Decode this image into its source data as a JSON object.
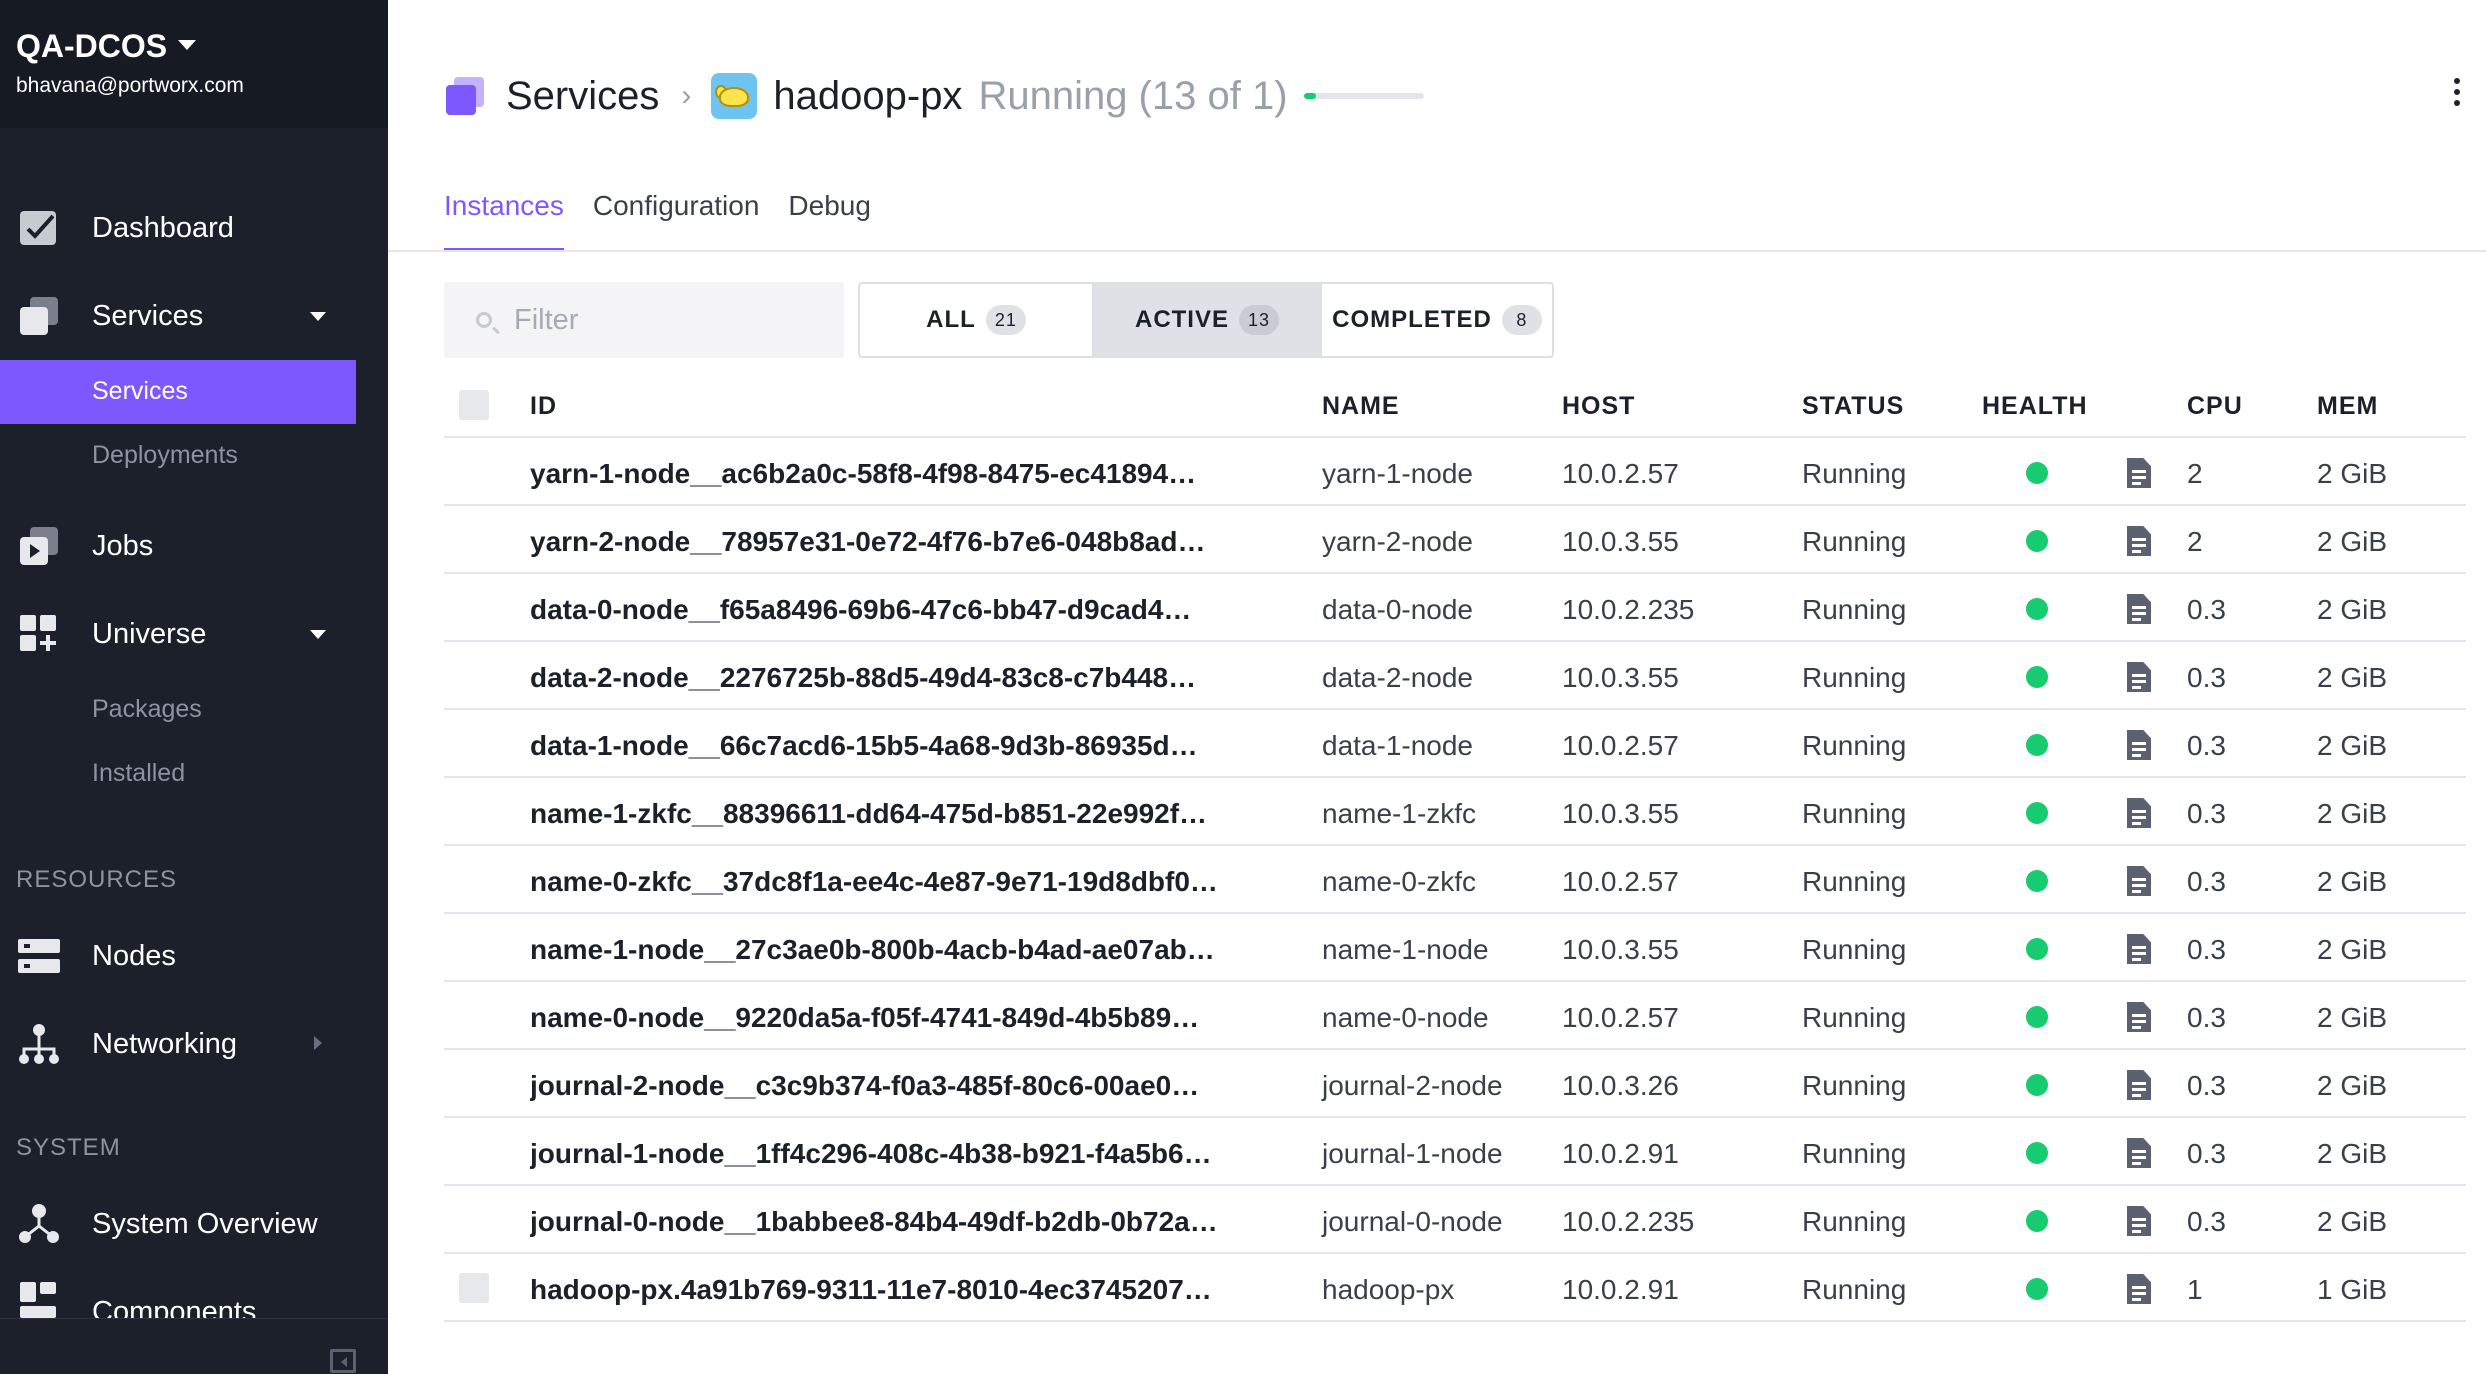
{
  "sidebar": {
    "cluster_name": "QA-DCOS",
    "user_email": "bhavana@portworx.com",
    "items": [
      {
        "label": "Dashboard",
        "icon": "dashboard-icon"
      },
      {
        "label": "Services",
        "icon": "services-icon"
      },
      {
        "label": "Jobs",
        "icon": "jobs-icon"
      },
      {
        "label": "Universe",
        "icon": "universe-icon"
      },
      {
        "label": "Nodes",
        "icon": "nodes-icon"
      },
      {
        "label": "Networking",
        "icon": "networking-icon"
      },
      {
        "label": "System Overview",
        "icon": "system-overview-icon"
      },
      {
        "label": "Components",
        "icon": "components-icon"
      }
    ],
    "services_sub": [
      "Services",
      "Deployments"
    ],
    "universe_sub": [
      "Packages",
      "Installed"
    ],
    "sections": [
      "RESOURCES",
      "SYSTEM"
    ]
  },
  "header": {
    "breadcrumb_root": "Services",
    "breadcrumb_sep": "›",
    "service_name": "hadoop-px",
    "status": "Running (13 of 1)",
    "progress": 0.1,
    "accent": "#7d58ff",
    "status_color": "#16cb70"
  },
  "tabs": [
    "Instances",
    "Configuration",
    "Debug"
  ],
  "filter": {
    "placeholder": "Filter"
  },
  "segments": [
    {
      "label": "ALL",
      "count": "21"
    },
    {
      "label": "ACTIVE",
      "count": "13"
    },
    {
      "label": "COMPLETED",
      "count": "8"
    }
  ],
  "table": {
    "columns": [
      "ID",
      "NAME",
      "HOST",
      "STATUS",
      "HEALTH",
      "CPU",
      "MEM"
    ],
    "rows": [
      {
        "id": "yarn-1-node__ac6b2a0c-58f8-4f98-8475-ec41894…",
        "name": "yarn-1-node",
        "host": "10.0.2.57",
        "status": "Running",
        "cpu": "2",
        "mem": "2 GiB"
      },
      {
        "id": "yarn-2-node__78957e31-0e72-4f76-b7e6-048b8ad…",
        "name": "yarn-2-node",
        "host": "10.0.3.55",
        "status": "Running",
        "cpu": "2",
        "mem": "2 GiB"
      },
      {
        "id": "data-0-node__f65a8496-69b6-47c6-bb47-d9cad4…",
        "name": "data-0-node",
        "host": "10.0.2.235",
        "status": "Running",
        "cpu": "0.3",
        "mem": "2 GiB"
      },
      {
        "id": "data-2-node__2276725b-88d5-49d4-83c8-c7b448…",
        "name": "data-2-node",
        "host": "10.0.3.55",
        "status": "Running",
        "cpu": "0.3",
        "mem": "2 GiB"
      },
      {
        "id": "data-1-node__66c7acd6-15b5-4a68-9d3b-86935d…",
        "name": "data-1-node",
        "host": "10.0.2.57",
        "status": "Running",
        "cpu": "0.3",
        "mem": "2 GiB"
      },
      {
        "id": "name-1-zkfc__88396611-dd64-475d-b851-22e992f…",
        "name": "name-1-zkfc",
        "host": "10.0.3.55",
        "status": "Running",
        "cpu": "0.3",
        "mem": "2 GiB"
      },
      {
        "id": "name-0-zkfc__37dc8f1a-ee4c-4e87-9e71-19d8dbf0…",
        "name": "name-0-zkfc",
        "host": "10.0.2.57",
        "status": "Running",
        "cpu": "0.3",
        "mem": "2 GiB"
      },
      {
        "id": "name-1-node__27c3ae0b-800b-4acb-b4ad-ae07ab…",
        "name": "name-1-node",
        "host": "10.0.3.55",
        "status": "Running",
        "cpu": "0.3",
        "mem": "2 GiB"
      },
      {
        "id": "name-0-node__9220da5a-f05f-4741-849d-4b5b89…",
        "name": "name-0-node",
        "host": "10.0.2.57",
        "status": "Running",
        "cpu": "0.3",
        "mem": "2 GiB"
      },
      {
        "id": "journal-2-node__c3c9b374-f0a3-485f-80c6-00ae0…",
        "name": "journal-2-node",
        "host": "10.0.3.26",
        "status": "Running",
        "cpu": "0.3",
        "mem": "2 GiB"
      },
      {
        "id": "journal-1-node__1ff4c296-408c-4b38-b921-f4a5b6…",
        "name": "journal-1-node",
        "host": "10.0.2.91",
        "status": "Running",
        "cpu": "0.3",
        "mem": "2 GiB"
      },
      {
        "id": "journal-0-node__1babbee8-84b4-49df-b2db-0b72a…",
        "name": "journal-0-node",
        "host": "10.0.2.235",
        "status": "Running",
        "cpu": "0.3",
        "mem": "2 GiB"
      },
      {
        "id": "hadoop-px.4a91b769-9311-11e7-8010-4ec3745207…",
        "name": "hadoop-px",
        "host": "10.0.2.91",
        "status": "Running",
        "cpu": "1",
        "mem": "1 GiB",
        "checkbox": true
      }
    ]
  }
}
